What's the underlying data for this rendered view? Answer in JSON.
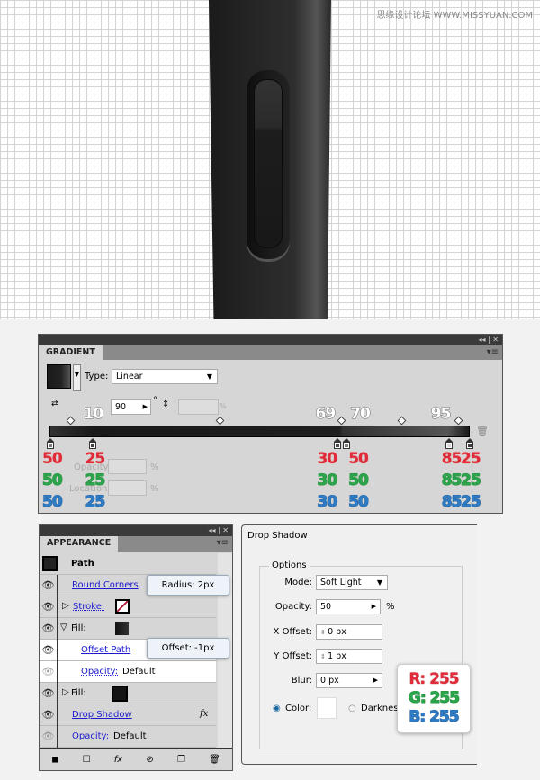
{
  "watermark": "思缘设计论坛 WWW.MISSYUAN.COM",
  "gradient": {
    "tab": "GRADIENT",
    "type_label": "Type:",
    "type_value": "Linear",
    "angle": "90",
    "degree": "°",
    "aspect_unit": "%",
    "opacity_label": "Opacity:",
    "location_label": "Location:",
    "pct": "%",
    "window_controls": "◂◂ | ✕",
    "location_labels": [
      "10",
      "69",
      "70",
      "95"
    ],
    "stops": [
      {
        "location": 0,
        "rgb": "50"
      },
      {
        "location": 10,
        "rgb": "25"
      },
      {
        "location": 69,
        "rgb": "30"
      },
      {
        "location": 70,
        "rgb": "50"
      },
      {
        "location": 95,
        "rgb": "85"
      },
      {
        "location": 100,
        "rgb": "25"
      }
    ]
  },
  "appearance": {
    "tab": "APPEARANCE",
    "window_controls": "◂◂ | ✕",
    "title": "Path",
    "rows": {
      "round_corners": "Round Corners",
      "stroke": "Stroke:",
      "fill1": "Fill:",
      "offset_path": "Offset Path",
      "opacity1": "Opacity:",
      "opacity1_val": "Default",
      "fill2": "Fill:",
      "drop_shadow": "Drop Shadow",
      "opacity2": "Opacity:",
      "opacity2_val": "Default"
    },
    "tooltips": {
      "radius": "Radius: 2px",
      "offset": "Offset: -1px"
    },
    "fx": "fx"
  },
  "drop_shadow": {
    "title": "Drop Shadow",
    "options": "Options",
    "mode_label": "Mode:",
    "mode": "Soft Light",
    "opacity_label": "Opacity:",
    "opacity": "50",
    "opacity_unit": "%",
    "x_label": "X Offset:",
    "x": "0 px",
    "y_label": "Y Offset:",
    "y": "1 px",
    "blur_label": "Blur:",
    "blur": "0 px",
    "color_label": "Color:",
    "darkness_label": "Darknes",
    "color_hex": "#ffffff",
    "rgb": {
      "r": "R: 255",
      "g": "G: 255",
      "b": "B: 255"
    }
  }
}
